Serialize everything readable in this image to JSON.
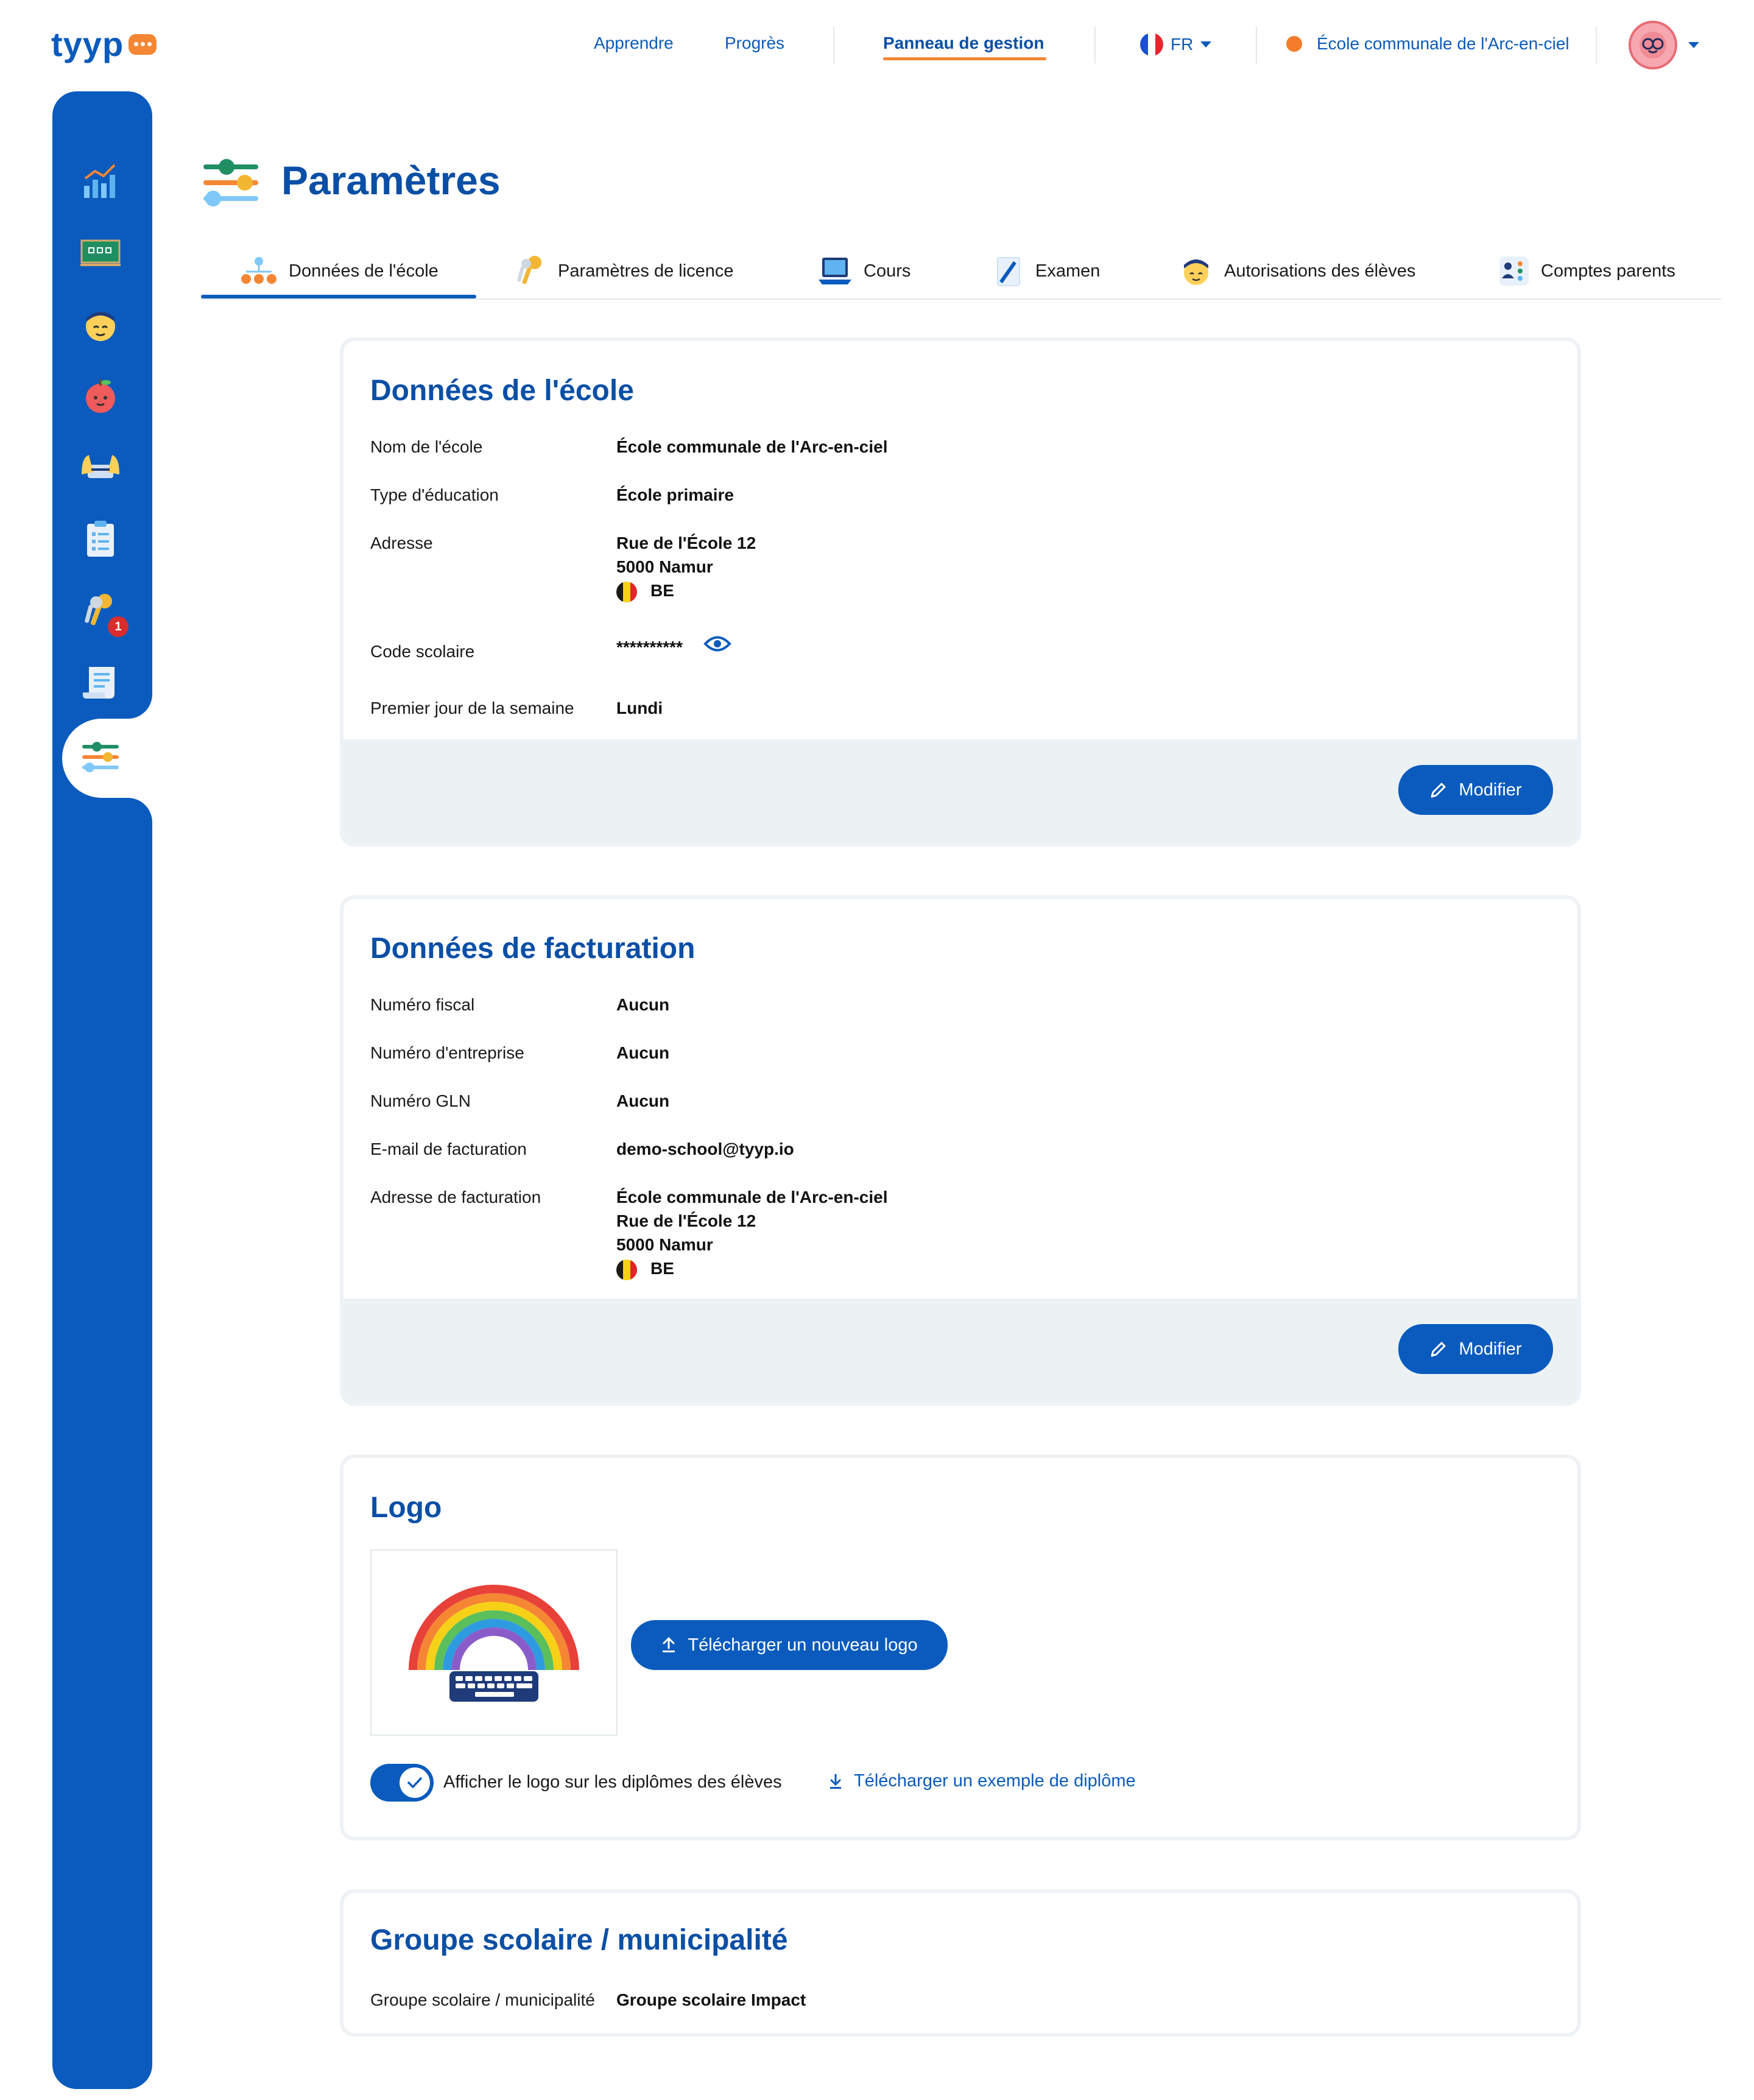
{
  "brand": {
    "name": "tyyp"
  },
  "topnav": {
    "items": [
      "Apprendre",
      "Progrès",
      "Panneau de gestion"
    ],
    "language": "FR",
    "school": "École communale de l'Arc-en-ciel"
  },
  "sidebar": {
    "items": [
      {
        "icon": "chart-icon"
      },
      {
        "icon": "classroom-board-icon"
      },
      {
        "icon": "student-icon"
      },
      {
        "icon": "apple-character-icon"
      },
      {
        "icon": "hands-keyboard-icon"
      },
      {
        "icon": "clipboard-checklist-icon"
      },
      {
        "icon": "keys-icon",
        "badge": "1"
      },
      {
        "icon": "certificate-scroll-icon"
      },
      {
        "icon": "settings-sliders-icon",
        "active": true
      }
    ]
  },
  "page": {
    "title": "Paramètres"
  },
  "tabs": [
    {
      "label": "Données de l'école",
      "active": true
    },
    {
      "label": "Paramètres de licence"
    },
    {
      "label": "Cours"
    },
    {
      "label": "Examen"
    },
    {
      "label": "Autorisations des élèves"
    },
    {
      "label": "Comptes parents"
    }
  ],
  "school_data": {
    "title": "Données de l'école",
    "fields": {
      "name_label": "Nom de l'école",
      "name_value": "École communale de l'Arc-en-ciel",
      "type_label": "Type d'éducation",
      "type_value": "École primaire",
      "address_label": "Adresse",
      "address_line1": "Rue de l'École 12",
      "address_line2": "5000 Namur",
      "address_country": "BE",
      "code_label": "Code scolaire",
      "code_value": "**********",
      "week_label": "Premier jour de la semaine",
      "week_value": "Lundi"
    },
    "edit_label": "Modifier"
  },
  "billing_data": {
    "title": "Données de facturation",
    "fields": {
      "tax_label": "Numéro fiscal",
      "tax_value": "Aucun",
      "company_label": "Numéro d'entreprise",
      "company_value": "Aucun",
      "gln_label": "Numéro GLN",
      "gln_value": "Aucun",
      "email_label": "E-mail de facturation",
      "email_value": "demo-school@tyyp.io",
      "address_label": "Adresse de facturation",
      "address_line1": "École communale de l'Arc-en-ciel",
      "address_line2": "Rue de l'École 12",
      "address_line3": "5000 Namur",
      "address_country": "BE"
    },
    "edit_label": "Modifier"
  },
  "logo_section": {
    "title": "Logo",
    "upload_label": "Télécharger un nouveau logo",
    "toggle_label": "Afficher le logo sur les diplômes des élèves",
    "toggle_on": true,
    "download_label": "Télécharger un exemple de diplôme"
  },
  "group_section": {
    "title": "Groupe scolaire / municipalité",
    "label": "Groupe scolaire / municipalité",
    "value": "Groupe scolaire Impact"
  },
  "colors": {
    "primary": "#0a5bbd",
    "accent": "#f58634",
    "card_border": "#eef2f4",
    "footer_bg": "#ecf2f4"
  }
}
